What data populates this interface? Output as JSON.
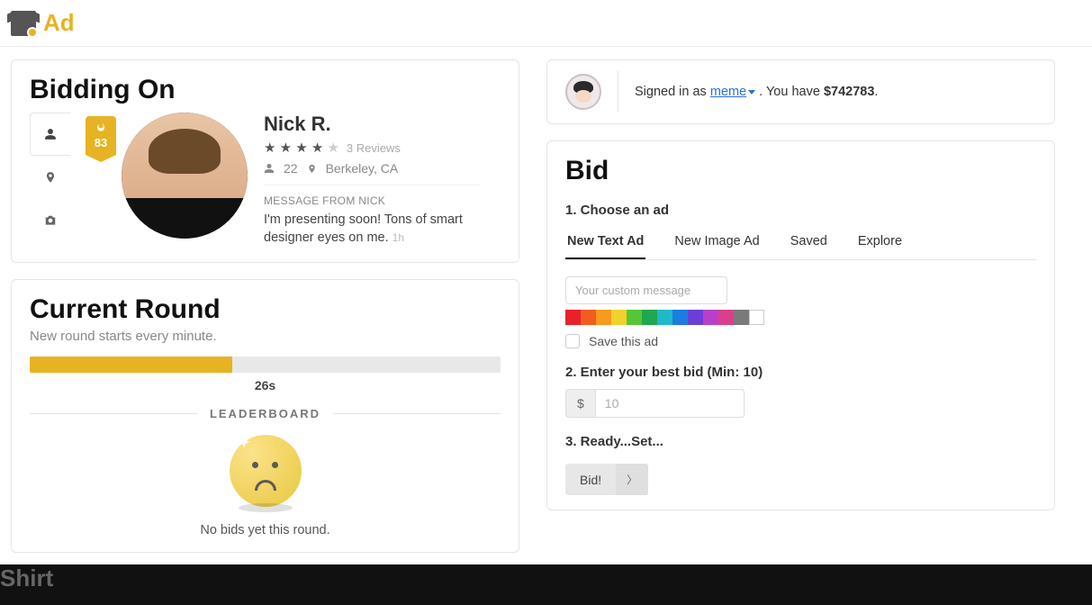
{
  "brand": {
    "prefix": "Ad",
    "suffix": "Shirt"
  },
  "biddingOn": {
    "title": "Bidding On",
    "flame_score": "83",
    "name": "Nick R.",
    "rating_stars": 4,
    "reviews": "3 Reviews",
    "age": "22",
    "location": "Berkeley, CA",
    "message_label": "MESSAGE FROM NICK",
    "message": "I'm presenting soon! Tons of smart designer eyes on me.",
    "message_time": "1h"
  },
  "round": {
    "title": "Current Round",
    "subtitle": "New round starts every minute.",
    "progress_pct": 43,
    "timer": "26s",
    "leaderboard_label": "LEADERBOARD",
    "no_bids": "No bids yet this round."
  },
  "signin": {
    "prefix": "Signed in as",
    "user": "meme",
    "mid": ". You have",
    "balance": "$742783",
    "suffix": "."
  },
  "bid": {
    "title": "Bid",
    "step1": "1. Choose an ad",
    "tabs": {
      "new_text": "New Text Ad",
      "new_image": "New Image Ad",
      "saved": "Saved",
      "explore": "Explore"
    },
    "msg_placeholder": "Your custom message",
    "save_label": "Save this ad",
    "step2": "2. Enter your best bid (Min: 10)",
    "currency": "$",
    "bid_placeholder": "10",
    "step3": "3. Ready...Set...",
    "button": "Bid!",
    "swatches": [
      "#e8212b",
      "#f25c1f",
      "#f59b1d",
      "#f0d12d",
      "#56c636",
      "#1fa84f",
      "#1fb9c9",
      "#1b7de0",
      "#6b3fd6",
      "#b93fc9",
      "#d93f8b",
      "#7a7a7a",
      "#ffffff"
    ]
  }
}
